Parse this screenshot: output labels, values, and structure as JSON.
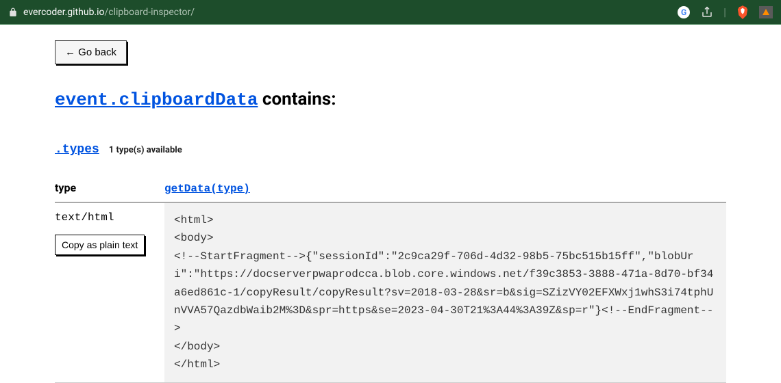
{
  "browser": {
    "url_host": "evercoder.github.io",
    "url_path": "/clipboard-inspector/",
    "g_letter": "G"
  },
  "page": {
    "go_back_label": "← Go back",
    "heading_link": "event.clipboardData",
    "heading_suffix": " contains:",
    "types_label": ".types",
    "types_count": "1 type(s) available",
    "table": {
      "header_type": "type",
      "header_getdata": "getData(type)",
      "row": {
        "type": "text/html",
        "copy_label": "Copy as plain text",
        "data": "<html>\n<body>\n<!--StartFragment-->{\"sessionId\":\"2c9ca29f-706d-4d32-98b5-75bc515b15ff\",\"blobUri\":\"https://docserverpwaprodcca.blob.core.windows.net/f39c3853-3888-471a-8d70-bf34a6ed861c-1/copyResult/copyResult?sv=2018-03-28&sr=b&sig=SZizVY02EFXWxj1whS3i74tphUnVVA57QazdbWaib2M%3D&spr=https&se=2023-04-30T21%3A44%3A39Z&sp=r\"}<!--EndFragment-->\n</body>\n</html>"
      }
    }
  }
}
